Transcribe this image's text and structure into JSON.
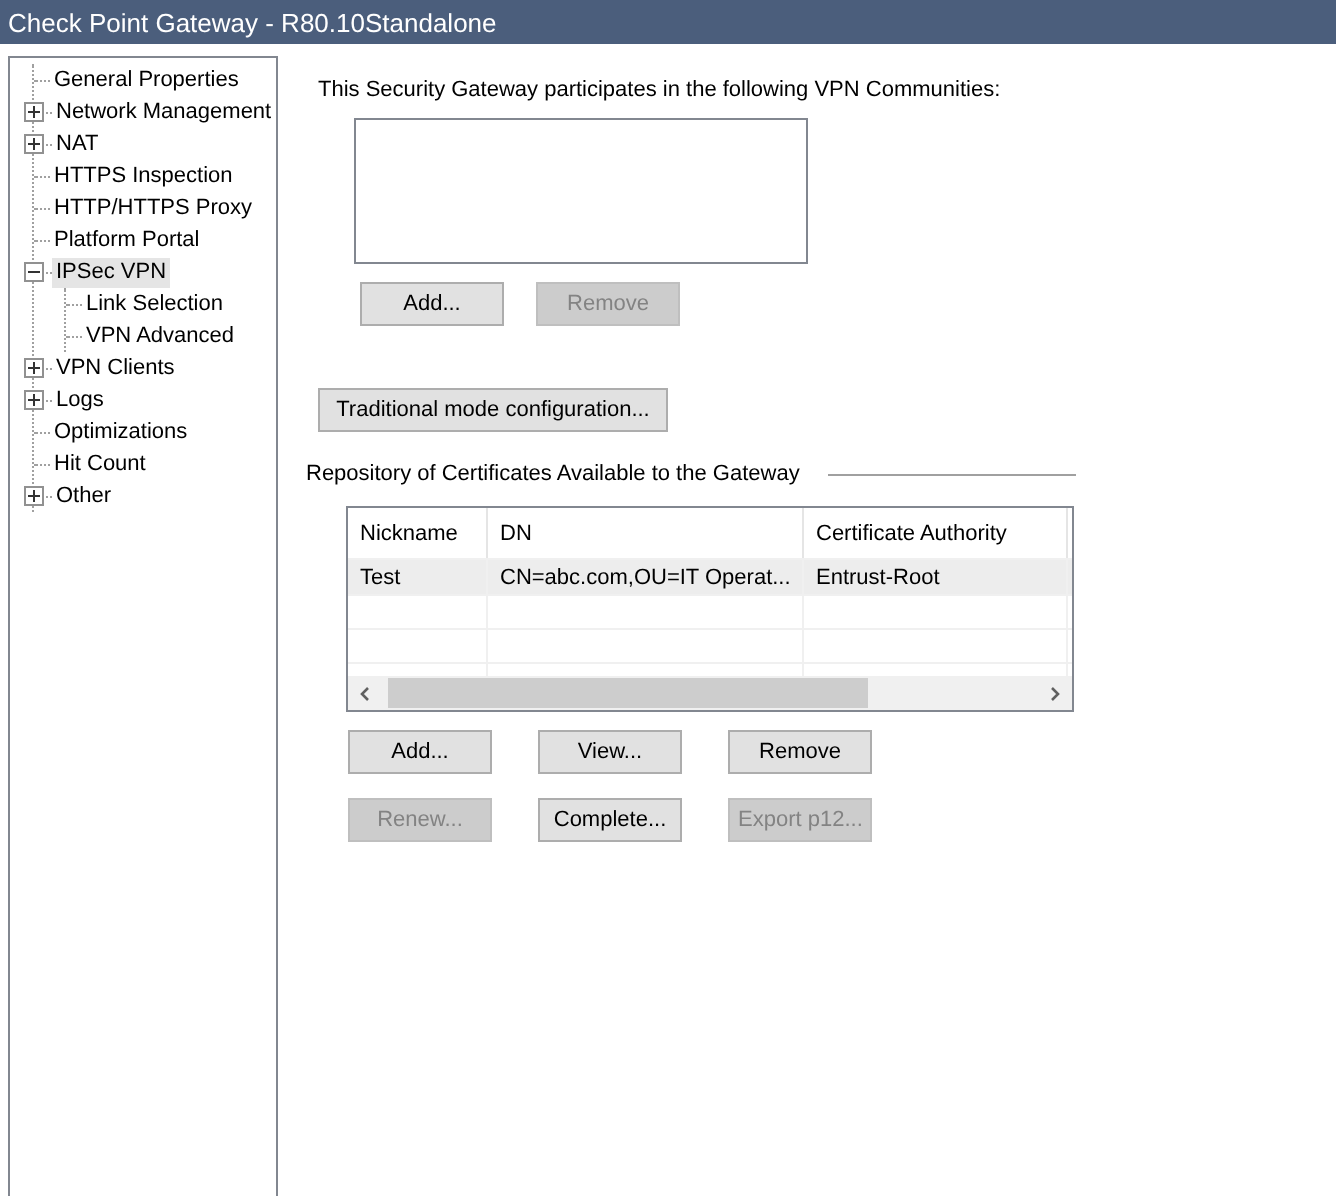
{
  "window": {
    "title": "Check Point Gateway - R80.10Standalone"
  },
  "tree": [
    {
      "label": "General Properties",
      "selected": false
    },
    {
      "label": "Network Management",
      "selected": false,
      "expanded": false
    },
    {
      "label": "NAT",
      "selected": false,
      "expanded": false
    },
    {
      "label": "HTTPS Inspection",
      "selected": false
    },
    {
      "label": "HTTP/HTTPS Proxy",
      "selected": false
    },
    {
      "label": "Platform Portal",
      "selected": false
    },
    {
      "label": "IPSec VPN",
      "selected": true,
      "expanded": true,
      "children": [
        {
          "label": "Link Selection",
          "selected": false
        },
        {
          "label": "VPN Advanced",
          "selected": false
        }
      ]
    },
    {
      "label": "VPN Clients",
      "selected": false,
      "expanded": false
    },
    {
      "label": "Logs",
      "selected": false,
      "expanded": false
    },
    {
      "label": "Optimizations",
      "selected": false
    },
    {
      "label": "Hit Count",
      "selected": false
    },
    {
      "label": "Other",
      "selected": false,
      "expanded": false
    }
  ],
  "communities": {
    "label": "This Security Gateway participates in the following VPN Communities:",
    "buttons": [
      {
        "label": "Add...",
        "disabled": false
      },
      {
        "label": "Remove",
        "disabled": true
      }
    ]
  },
  "traditional_button": "Traditional mode configuration...",
  "certificates": {
    "label": "Repository of Certificates Available to the Gateway",
    "columns": [
      "Nickname",
      "DN",
      "Certificate Authority"
    ],
    "rows": [
      {
        "cells": [
          "Test",
          "CN=abc.com,OU=IT Operat...",
          "Entrust-Root"
        ],
        "selected": true
      }
    ],
    "buttons": [
      {
        "label": "Add...",
        "disabled": false
      },
      {
        "label": "View...",
        "disabled": false
      },
      {
        "label": "Remove",
        "disabled": false
      },
      {
        "label": "Renew...",
        "disabled": true
      },
      {
        "label": "Complete...",
        "disabled": false
      },
      {
        "label": "Export p12...",
        "disabled": true
      }
    ]
  }
}
